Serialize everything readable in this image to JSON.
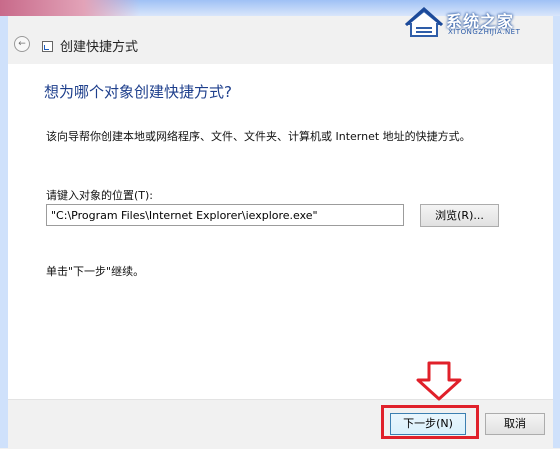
{
  "watermark": {
    "brand": "系统之家",
    "url": "XITONGZHIJIA.NET",
    "icon": "house-logo-icon"
  },
  "header": {
    "back_icon": "back-arrow-icon",
    "window_icon": "shortcut-wizard-icon",
    "title": "创建快捷方式"
  },
  "main": {
    "heading": "想为哪个对象创建快捷方式?",
    "description": "该向导帮你创建本地或网络程序、文件、文件夹、计算机或 Internet 地址的快捷方式。",
    "location_label": "请键入对象的位置(T):",
    "location_value": "\"C:\\Program Files\\Internet Explorer\\iexplore.exe\"",
    "browse_label": "浏览(R)...",
    "hint": "单击\"下一步\"继续。"
  },
  "footer": {
    "next_label": "下一步(N)",
    "cancel_label": "取消"
  },
  "annotations": {
    "arrow_icon": "down-arrow-icon",
    "highlight_color": "#e0202a"
  },
  "colors": {
    "heading": "#1e3f8c",
    "panel": "#ffffff",
    "chrome": "#f1f1f1"
  }
}
